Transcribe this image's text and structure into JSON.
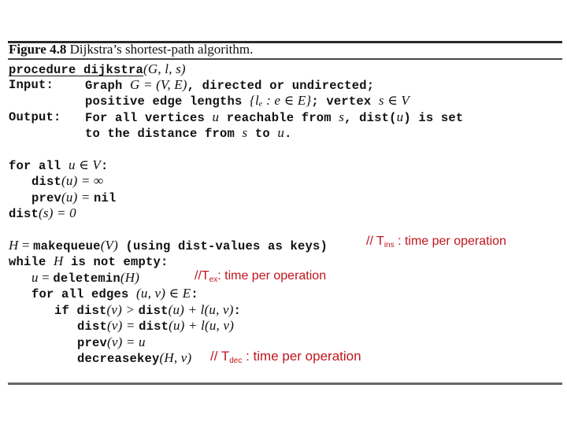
{
  "caption": {
    "label": "Figure 4.8",
    "title": " Dijkstra’s shortest-path algorithm."
  },
  "header": {
    "procedure_kw": "procedure",
    "procedure_name": "dijkstra",
    "procedure_args": "(G, l, s)",
    "input_label": "Input:",
    "input_line1_a": "Graph ",
    "input_line1_math": "G = (V, E)",
    "input_line1_b": ", directed or undirected;",
    "input_line2_a": "positive edge lengths ",
    "input_line2_math": "{lₑ : e ∈ E}",
    "input_line2_b": "; vertex ",
    "input_line2_math2": "s ∈ V",
    "output_label": "Output:",
    "output_line1_a": "For all vertices ",
    "output_line1_u": "u",
    "output_line1_b": " reachable from ",
    "output_line1_s": "s",
    "output_line1_c": ", dist(",
    "output_line1_u2": "u",
    "output_line1_d": ") is set",
    "output_line2_a": "to the distance from ",
    "output_line2_s": "s",
    "output_line2_b": " to ",
    "output_line2_u": "u",
    "output_line2_c": "."
  },
  "init": {
    "forall_a": "for all ",
    "forall_math": "u ∈ V",
    "forall_b": ":",
    "dist_kw": "dist",
    "dist_arg": "(u) = ∞",
    "prev_kw": "prev",
    "prev_arg": "(u) = ",
    "prev_val": "nil",
    "dists_kw": "dist",
    "dists_arg": "(s) = 0"
  },
  "main": {
    "H": "H",
    "eq": " = ",
    "makequeue_kw": "makequeue",
    "makequeue_arg": "(V)",
    "makequeue_note": "  (using dist-values as keys)",
    "while_a": "while ",
    "while_b": " is not empty:",
    "u": "u",
    "deletemin_kw": "deletemin",
    "deletemin_arg": "(H)",
    "foredges_a": "for all edges ",
    "foredges_math": "(u, v) ∈ E",
    "foredges_b": ":",
    "if_kw": "if ",
    "if_dist1": "dist",
    "if_arg1": "(v) > ",
    "if_dist2": "dist",
    "if_arg2": "(u) + l(u, v)",
    "if_colon": ":",
    "upd_dist1": "dist",
    "upd_arg1": "(v) = ",
    "upd_dist2": "dist",
    "upd_arg2": "(u) + l(u, v)",
    "prev_kw": "prev",
    "prev_arg": "(v) = u",
    "dec_kw": "decreasekey",
    "dec_arg": "(H, v)"
  },
  "annotations": {
    "color": "#c0151d",
    "ins_prefix": "// T",
    "ins_sub": "ins",
    "ins_suffix": " : time per operation",
    "ex_prefix": "//T",
    "ex_sub": "ex",
    "ex_suffix": ": time per operation",
    "dec_prefix": "// T",
    "dec_sub": "dec",
    "dec_suffix": " : time per operation"
  }
}
